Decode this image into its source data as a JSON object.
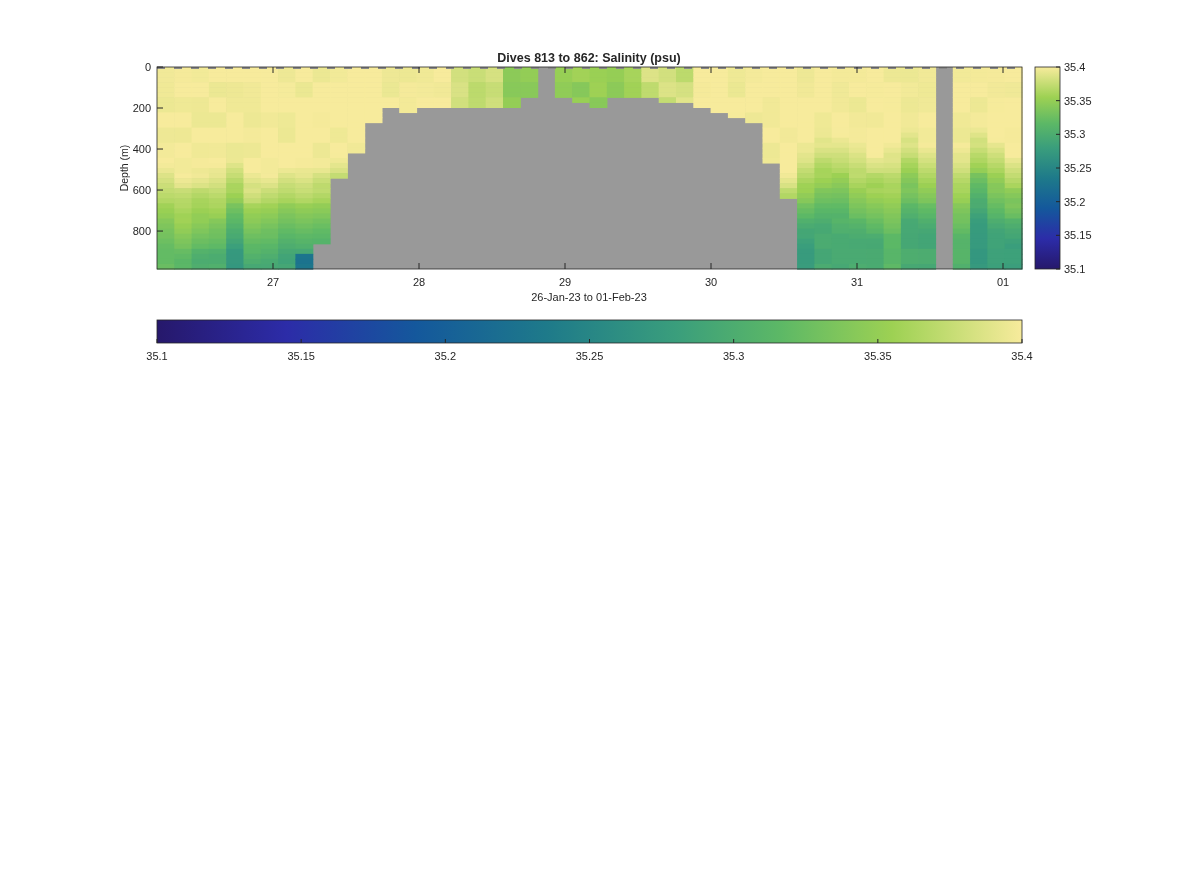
{
  "figure": {
    "title": "Dives 813 to 862: Salinity (psu)",
    "ylabel": "Depth (m)",
    "xlabel": "26-Jan-23 to 01-Feb-23",
    "yticks": [
      "0",
      "200",
      "400",
      "600",
      "800"
    ],
    "xticks": [
      "27",
      "28",
      "29",
      "30",
      "31",
      "01"
    ],
    "colorbar_ticks": [
      "35.4",
      "35.35",
      "35.3",
      "35.25",
      "35.2",
      "35.15",
      "35.1"
    ],
    "horizontal_colorbar_ticks": [
      "35.1",
      "35.15",
      "35.2",
      "35.25",
      "35.3",
      "35.35",
      "35.4"
    ]
  }
}
